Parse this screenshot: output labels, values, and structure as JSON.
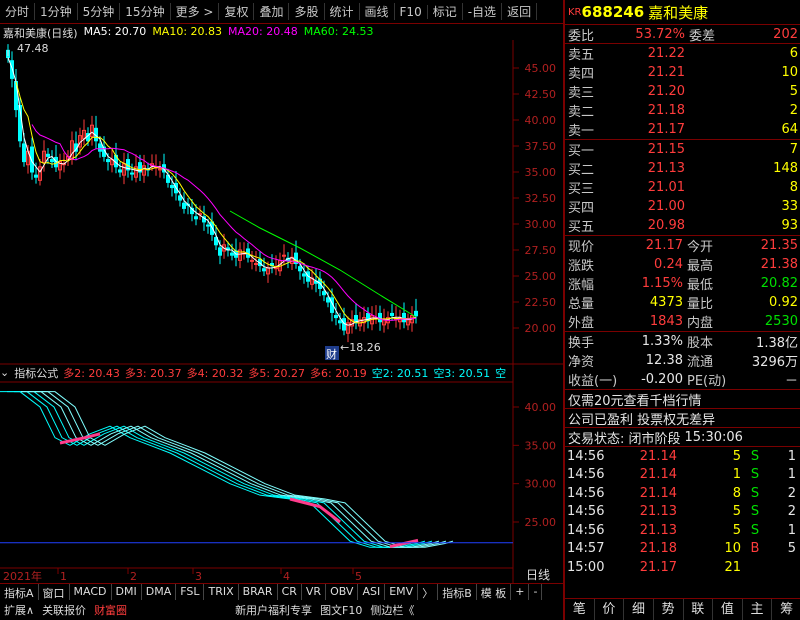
{
  "toolbar": {
    "items": [
      "分时",
      "1分钟",
      "5分钟",
      "15分钟",
      "更多 >",
      "复权",
      "叠加",
      "多股",
      "统计",
      "画线",
      "F10",
      "标记",
      "-自选",
      "返回"
    ]
  },
  "chart": {
    "title": "嘉和美康(日线)",
    "ma5": "MA5: 20.70",
    "ma10": "MA10: 20.83",
    "ma20": "MA20: 20.48",
    "ma60": "MA60: 24.53",
    "high_label": "47.48",
    "low_label": "18.26",
    "cai_label": "财",
    "yticks": [
      "45.00",
      "42.50",
      "40.00",
      "37.50",
      "35.00",
      "32.50",
      "30.00",
      "27.50",
      "25.00",
      "22.50",
      "20.00"
    ],
    "ind_yticks": [
      "40.00",
      "35.00",
      "30.00",
      "25.00"
    ],
    "xlabels": [
      "2021年",
      "1",
      "2",
      "3",
      "4",
      "5"
    ],
    "day_label": "日线"
  },
  "indicator": {
    "name": "指标公式",
    "items": [
      "多2: 20.43",
      "多3: 20.37",
      "多4: 20.32",
      "多5: 20.27",
      "多6: 20.19",
      "空2: 20.51",
      "空3: 20.51",
      "空"
    ]
  },
  "tabs": [
    "指标A",
    "窗口",
    "MACD",
    "DMI",
    "DMA",
    "FSL",
    "TRIX",
    "BRAR",
    "CR",
    "VR",
    "OBV",
    "ASI",
    "EMV",
    "〉",
    "指标B",
    "模 板",
    "+",
    "-"
  ],
  "tabs2": [
    "扩展∧",
    "关联报价",
    "财富圈",
    "新用户福利专享",
    "图文F10",
    "侧边栏《"
  ],
  "quote": {
    "code": "688246",
    "name": "嘉和美康",
    "kr": "KR",
    "weibi": "委比",
    "weibi_v": "53.72%",
    "weicha": "委差",
    "weicha_v": "202",
    "asks": [
      {
        "l": "卖五",
        "p": "21.22",
        "v": "6"
      },
      {
        "l": "卖四",
        "p": "21.21",
        "v": "10"
      },
      {
        "l": "卖三",
        "p": "21.20",
        "v": "5"
      },
      {
        "l": "卖二",
        "p": "21.18",
        "v": "2"
      },
      {
        "l": "卖一",
        "p": "21.17",
        "v": "64"
      }
    ],
    "bids": [
      {
        "l": "买一",
        "p": "21.15",
        "v": "7"
      },
      {
        "l": "买二",
        "p": "21.13",
        "v": "148"
      },
      {
        "l": "买三",
        "p": "21.01",
        "v": "8"
      },
      {
        "l": "买四",
        "p": "21.00",
        "v": "33"
      },
      {
        "l": "买五",
        "p": "20.98",
        "v": "93"
      }
    ],
    "stats": [
      [
        "现价",
        "21.17",
        "今开",
        "21.35"
      ],
      [
        "涨跌",
        "0.24",
        "最高",
        "21.38"
      ],
      [
        "涨幅",
        "1.15%",
        "最低",
        "20.82"
      ],
      [
        "总量",
        "4373",
        "量比",
        "0.92"
      ],
      [
        "外盘",
        "1843",
        "内盘",
        "2530"
      ]
    ],
    "stats2": [
      [
        "换手",
        "1.33%",
        "股本",
        "1.38亿"
      ],
      [
        "净资",
        "12.38",
        "流通",
        "3296万"
      ],
      [
        "收益(一)",
        "-0.200",
        "PE(动)",
        "－"
      ]
    ],
    "promo1": "仅需20元查看千档行情",
    "promo2": "公司已盈利 投票权无差异",
    "status": "交易状态: 闭市阶段",
    "status_time": "15:30:06",
    "ticks": [
      [
        "14:56",
        "21.14",
        "5",
        "S",
        "1"
      ],
      [
        "14:56",
        "21.14",
        "1",
        "S",
        "1"
      ],
      [
        "14:56",
        "21.14",
        "8",
        "S",
        "2"
      ],
      [
        "14:56",
        "21.13",
        "5",
        "S",
        "2"
      ],
      [
        "14:56",
        "21.13",
        "5",
        "S",
        "1"
      ],
      [
        "14:57",
        "21.18",
        "10",
        "B",
        "5"
      ],
      [
        "15:00",
        "21.17",
        "21",
        "",
        ""
      ]
    ],
    "bottom": [
      "笔",
      "价",
      "细",
      "势",
      "联",
      "值",
      "主",
      "筹"
    ]
  },
  "colors": {
    "up": "#ff3c3c",
    "down": "#00ffff",
    "ma5": "#ffffff",
    "ma10": "#ffff00",
    "ma20": "#ff00ff",
    "ma60": "#00ff00"
  }
}
